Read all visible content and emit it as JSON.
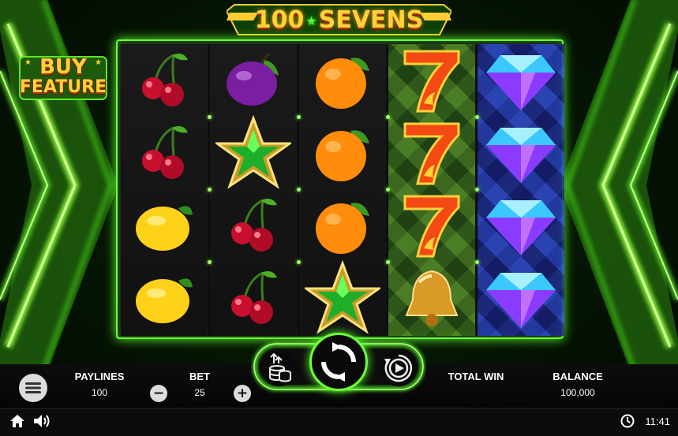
{
  "game": {
    "title_left": "100",
    "title_right": "SEVENS",
    "buy_feature_line1": "BUY",
    "buy_feature_line2": "FEATURE"
  },
  "reels": [
    [
      "cherry",
      "cherry",
      "lemon",
      "lemon"
    ],
    [
      "plum",
      "star",
      "cherry",
      "cherry"
    ],
    [
      "orange",
      "orange",
      "orange",
      "star"
    ],
    [
      "seven",
      "seven",
      "seven",
      "bell"
    ],
    [
      "diamond",
      "diamond",
      "diamond",
      "diamond"
    ]
  ],
  "panel": {
    "paylines_label": "PAYLINES",
    "paylines_value": "100",
    "bet_label": "BET",
    "bet_value": "25",
    "bet_minus": "−",
    "bet_plus": "+",
    "total_win_label": "TOTAL WIN",
    "total_win_value": "",
    "balance_label": "BALANCE",
    "balance_value": "100,000"
  },
  "status": {
    "time": "11:41"
  },
  "colors": {
    "accent_green": "#6dff3a",
    "title_gold": "#ffd23a"
  },
  "icons": [
    "menu-icon",
    "coin-stack-icon",
    "spin-icon",
    "autoplay-icon",
    "home-icon",
    "sound-icon",
    "clock-icon"
  ]
}
